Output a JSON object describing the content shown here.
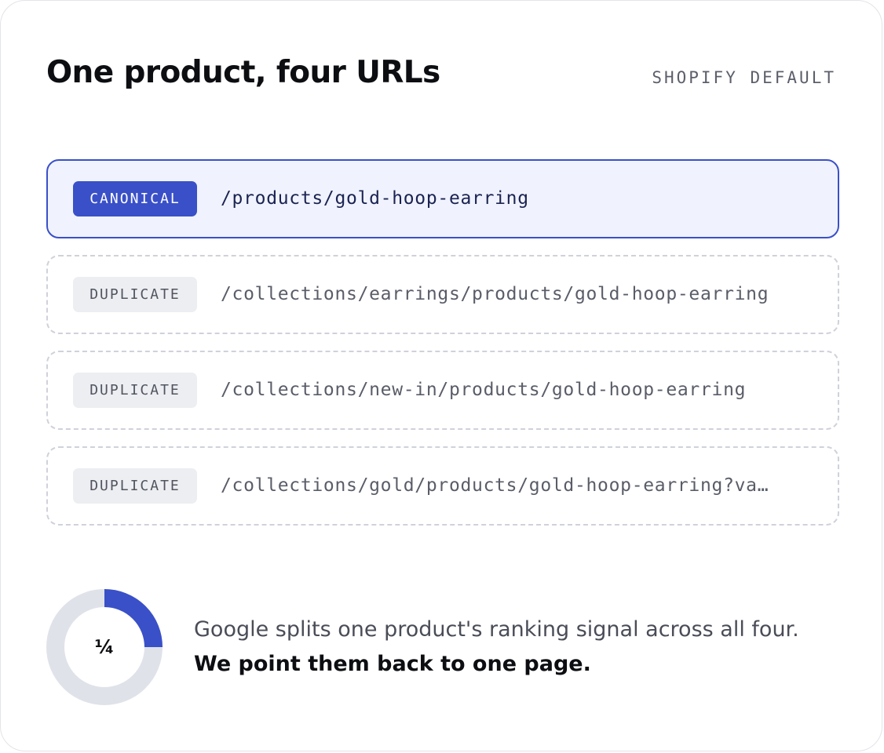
{
  "header": {
    "title": "One product, four URLs",
    "tag": "SHOPIFY DEFAULT"
  },
  "urls": [
    {
      "type": "canonical",
      "badge": "CANONICAL",
      "path": "/products/gold-hoop-earring"
    },
    {
      "type": "duplicate",
      "badge": "DUPLICATE",
      "path": "/collections/earrings/products/gold-hoop-earring"
    },
    {
      "type": "duplicate",
      "badge": "DUPLICATE",
      "path": "/collections/new-in/products/gold-hoop-earring"
    },
    {
      "type": "duplicate",
      "badge": "DUPLICATE",
      "path": "/collections/gold/products/gold-hoop-earring?va…"
    }
  ],
  "donut": {
    "label": "¼",
    "fraction": 0.25,
    "fill_color": "#3a50c8",
    "track_color": "#e0e2ea"
  },
  "summary": {
    "text": "Google splits one product's ranking signal across all four.",
    "emphasis": "We point them back to one page."
  },
  "colors": {
    "accent": "#3a50c8",
    "canonical_background": "#f0f3fd",
    "duplicate_border": "#cfd2da"
  }
}
